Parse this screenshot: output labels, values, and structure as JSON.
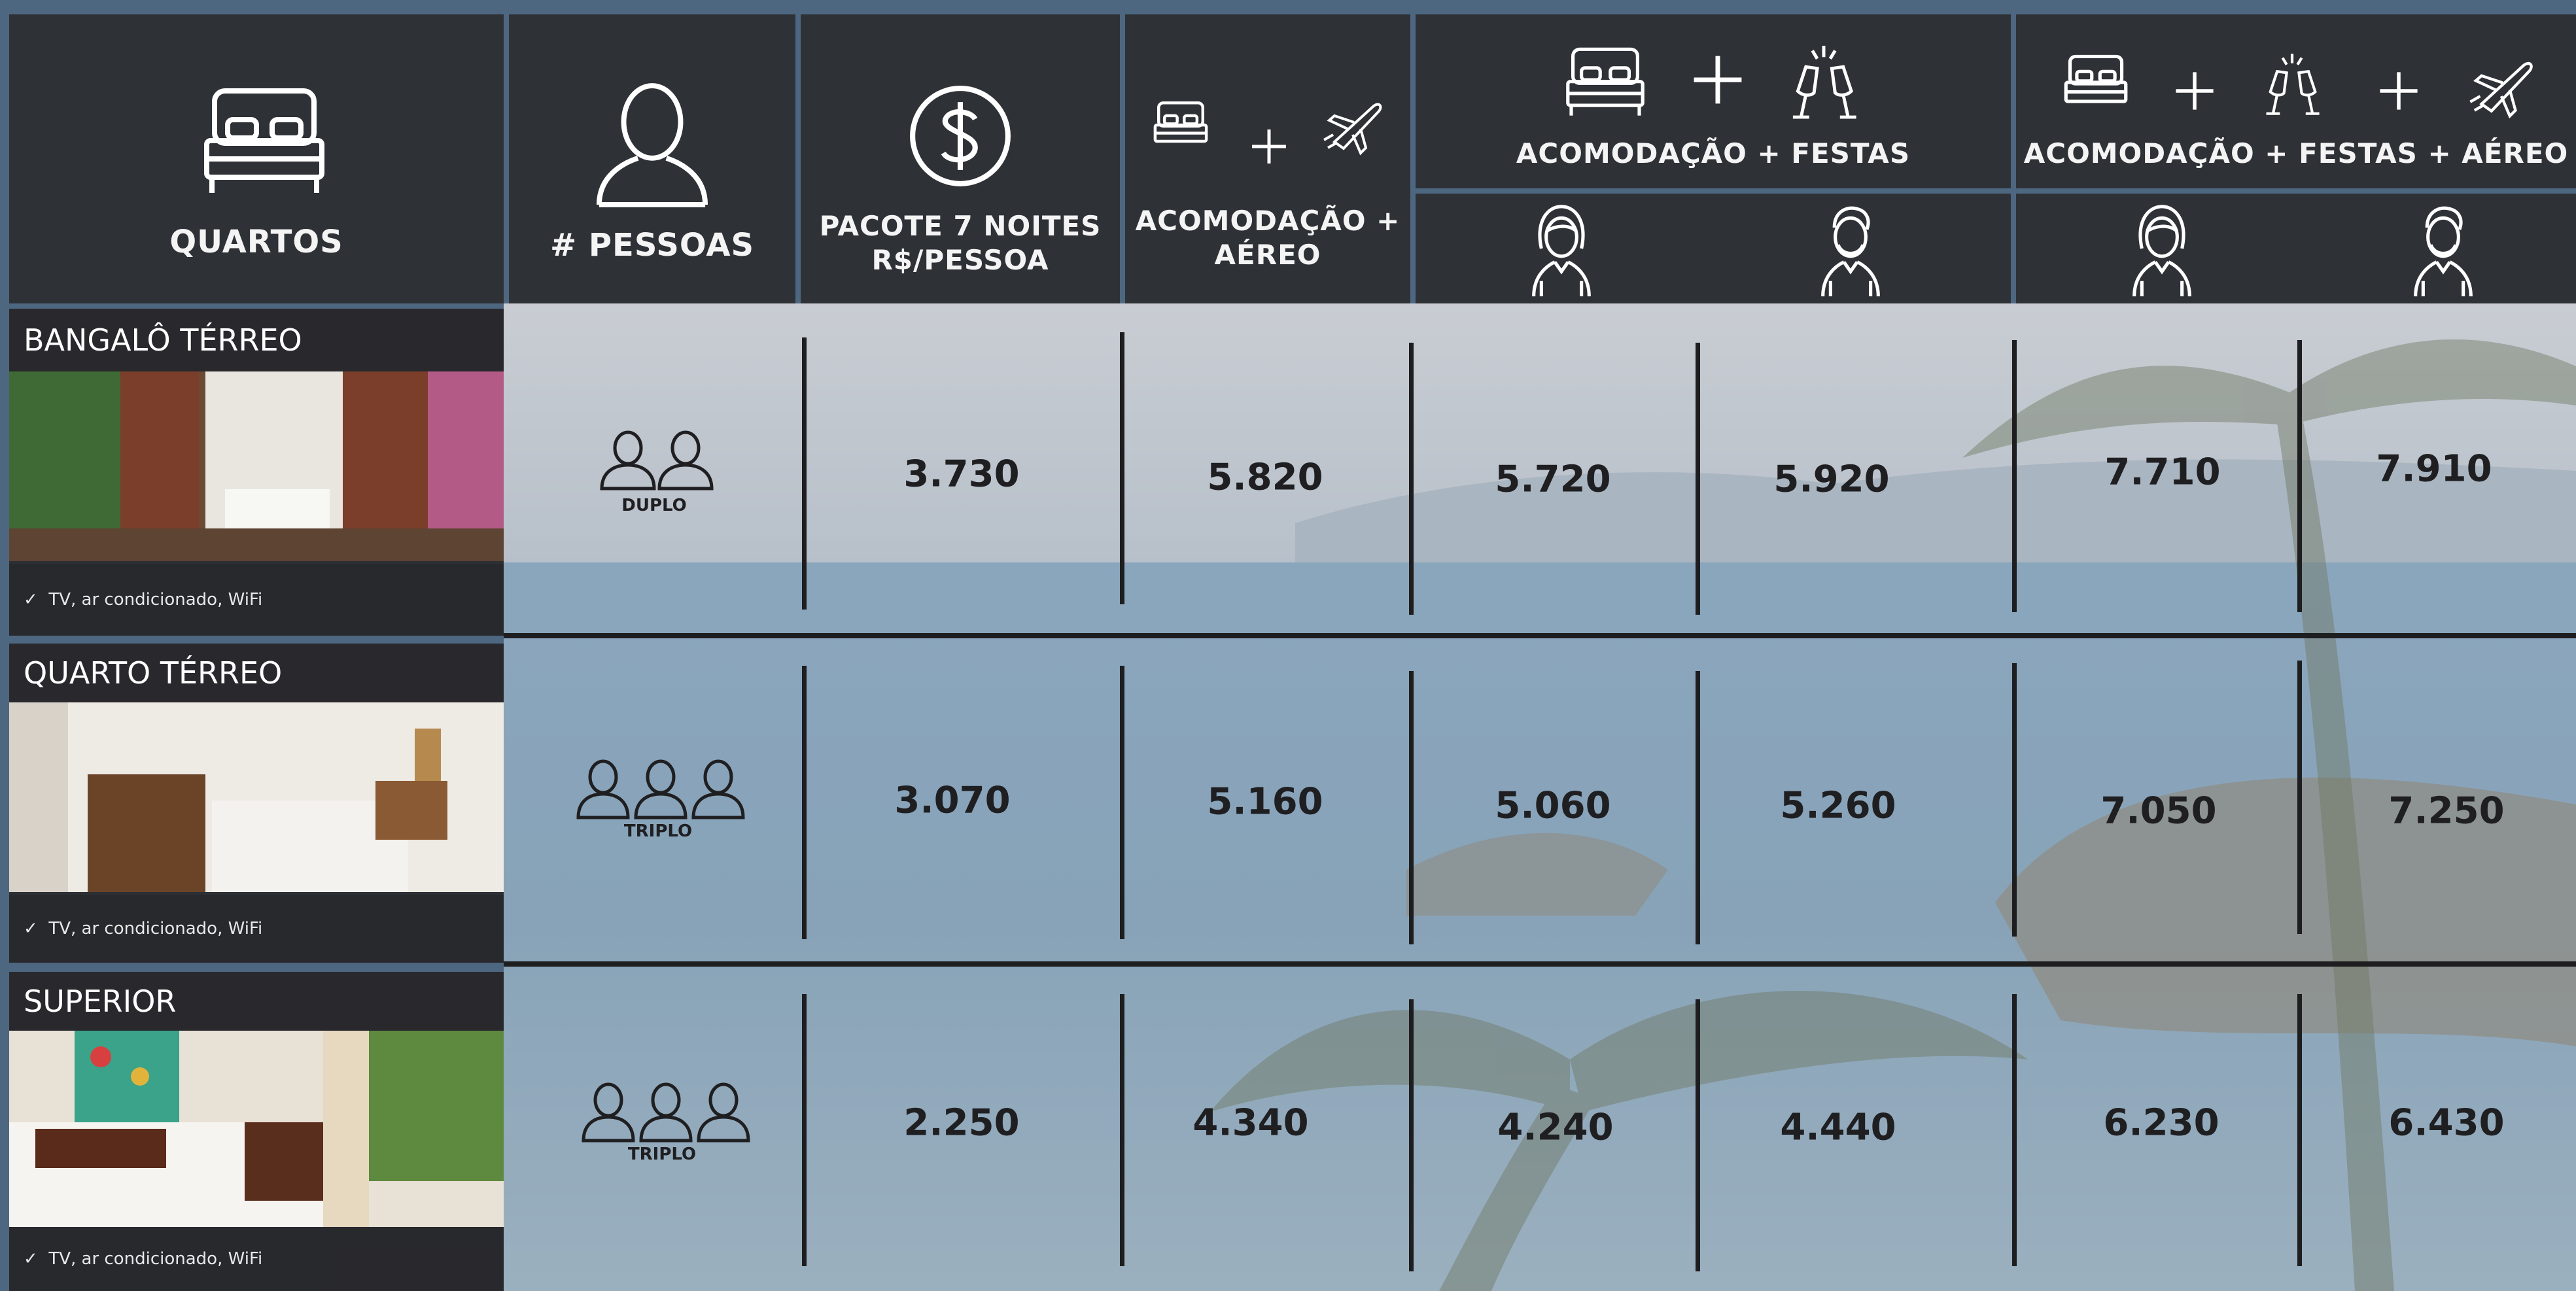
{
  "header": {
    "quartos": "QUARTOS",
    "pessoas": "# PESSOAS",
    "pacote_line1": "PACOTE 7 NOITES",
    "pacote_line2": "R$/PESSOA",
    "acom_aereo_line1": "ACOMODAÇÃO +",
    "acom_aereo_line2": "AÉREO",
    "acom_festas": "ACOMODAÇÃO + FESTAS",
    "acom_festas_aereo": "ACOMODAÇÃO + FESTAS + AÉREO"
  },
  "icons": {
    "quartos": "bed-icon",
    "pessoas": "person-icon",
    "pacote": "dollar-circle-icon",
    "acom_aereo": [
      "bed-icon",
      "plus-icon",
      "airplane-icon"
    ],
    "acom_festas": [
      "bed-icon",
      "plus-icon",
      "champagne-icon"
    ],
    "acom_festas_aereo": [
      "bed-icon",
      "plus-icon",
      "champagne-icon",
      "plus-icon",
      "airplane-icon"
    ],
    "subheaders": [
      "woman-icon",
      "man-icon",
      "woman-icon",
      "man-icon"
    ]
  },
  "rooms": [
    {
      "name": "BANGALÔ TÉRREO",
      "amenities": "TV, ar condicionado, WiFi",
      "occupancy": "DUPLO",
      "people_count": 2,
      "pacote": "3.730",
      "acom_aereo": "5.820",
      "festas_f": "5.720",
      "festas_m": "5.920",
      "festas_aereo_f": "7.710",
      "festas_aereo_m": "7.910"
    },
    {
      "name": "QUARTO TÉRREO",
      "amenities": "TV, ar condicionado, WiFi",
      "occupancy": "TRIPLO",
      "people_count": 3,
      "pacote": "3.070",
      "acom_aereo": "5.160",
      "festas_f": "5.060",
      "festas_m": "5.260",
      "festas_aereo_f": "7.050",
      "festas_aereo_m": "7.250"
    },
    {
      "name": "SUPERIOR",
      "amenities": "TV, ar condicionado, WiFi",
      "occupancy": "TRIPLO",
      "people_count": 3,
      "pacote": "2.250",
      "acom_aereo": "4.340",
      "festas_f": "4.240",
      "festas_m": "4.440",
      "festas_aereo_f": "6.230",
      "festas_aereo_m": "6.430"
    }
  ],
  "colors": {
    "header_bg": "#2e3136",
    "header_text": "#ffffff",
    "value_text": "#1f1f22",
    "divider": "#1e1e20"
  }
}
